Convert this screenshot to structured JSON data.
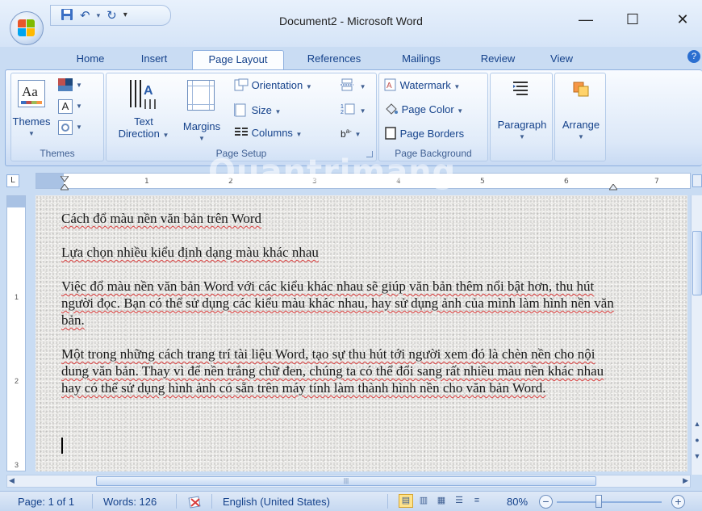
{
  "window": {
    "title": "Document2 - Microsoft Word",
    "minimize": "—",
    "maximize": "☐",
    "close": "✕"
  },
  "qat": {
    "save_icon": "save-icon",
    "undo_icon": "undo-icon",
    "redo_icon": "redo-icon",
    "customize": "▾"
  },
  "tabs": [
    "Home",
    "Insert",
    "Page Layout",
    "References",
    "Mailings",
    "Review",
    "View"
  ],
  "active_tab": "Page Layout",
  "ribbon": {
    "themes_group": {
      "label": "Themes",
      "themes_button": "Themes"
    },
    "page_setup_group": {
      "label": "Page Setup",
      "text_direction": "Text",
      "text_direction_2": "Direction",
      "margins": "Margins",
      "orientation": "Orientation",
      "size": "Size",
      "columns": "Columns"
    },
    "page_background_group": {
      "label": "Page Background",
      "watermark": "Watermark",
      "page_color": "Page Color",
      "page_borders": "Page Borders"
    },
    "paragraph": "Paragraph",
    "arrange": "Arrange"
  },
  "ruler": {
    "ticks": [
      "1",
      "2",
      "3",
      "4",
      "5",
      "6",
      "7"
    ],
    "tab_selector": "L"
  },
  "document": {
    "paragraphs": [
      "Cách đổ màu nền văn bản trên Word",
      "Lựa chọn nhiều kiểu định dạng màu khác nhau",
      "Việc đổ màu nền văn bản Word với các kiểu khác nhau sẽ giúp văn bản thêm nổi bật hơn, thu hút người đọc. Bạn có thể sử dụng các kiểu màu khác nhau, hay sử dụng ảnh của mình làm hình nền văn bản.",
      "Một trong những cách trang trí tài liệu Word, tạo sự thu hút tới người xem đó là chèn nền cho nội dung văn bản. Thay vì để nền trắng chữ đen, chúng ta có thể đổi sang rất nhiều màu nền khác nhau hay có thể sử dụng hình ảnh có sẵn trên máy tính làm thành hình nền cho văn bản Word."
    ]
  },
  "watermark_overlay": "Quantrimang",
  "statusbar": {
    "page": "Page: 1 of 1",
    "words": "Words: 126",
    "language": "English (United States)",
    "zoom": "80%",
    "zoom_out": "−",
    "zoom_in": "+",
    "zoom_level": 0.8
  },
  "colors": {
    "ribbon_text": "#15428b",
    "frame": "#c9dcf3",
    "spell_underline": "#d83b3b"
  }
}
